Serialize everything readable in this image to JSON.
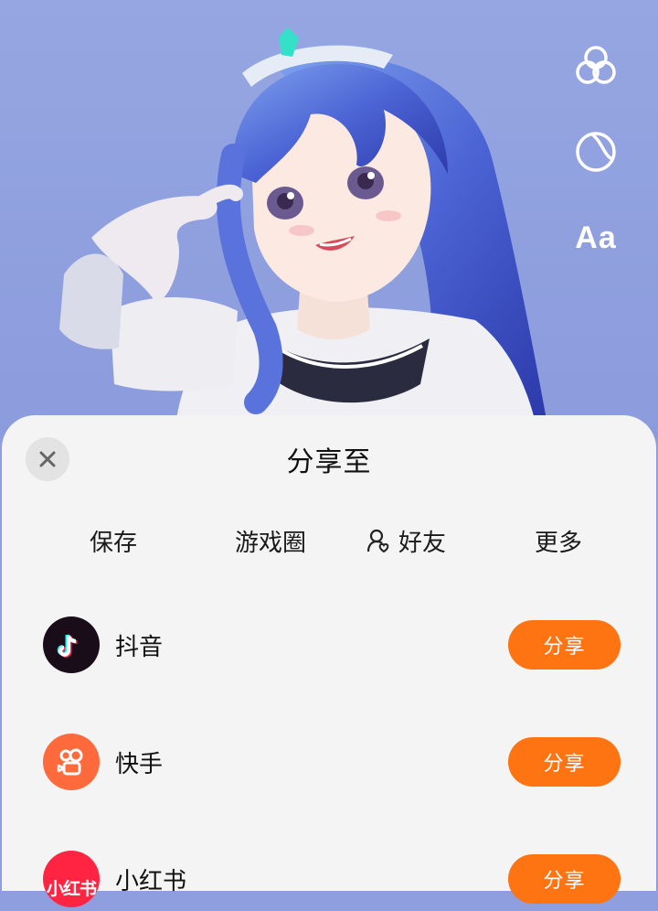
{
  "tools": {
    "filter_icon": "overlapping-circles",
    "sticker_icon": "moon",
    "text_label": "Aa"
  },
  "sheet": {
    "title": "分享至",
    "tabs": [
      {
        "label": "保存"
      },
      {
        "label": "游戏圈"
      },
      {
        "label": "好友",
        "icon": "friend-icon"
      },
      {
        "label": "更多"
      }
    ],
    "apps": [
      {
        "name": "抖音",
        "button": "分享",
        "icon": "douyin-icon",
        "color": "#1a0d1a"
      },
      {
        "name": "快手",
        "button": "分享",
        "icon": "kuaishou-icon",
        "color": "#ff6a3d"
      },
      {
        "name": "小红书",
        "button": "分享",
        "icon": "xiaohongshu-icon",
        "icon_text": "小红书",
        "color": "#ff2442"
      }
    ]
  },
  "colors": {
    "accent": "#ff7412",
    "background": "#8e9ede",
    "sheet": "#f4f4f4"
  }
}
